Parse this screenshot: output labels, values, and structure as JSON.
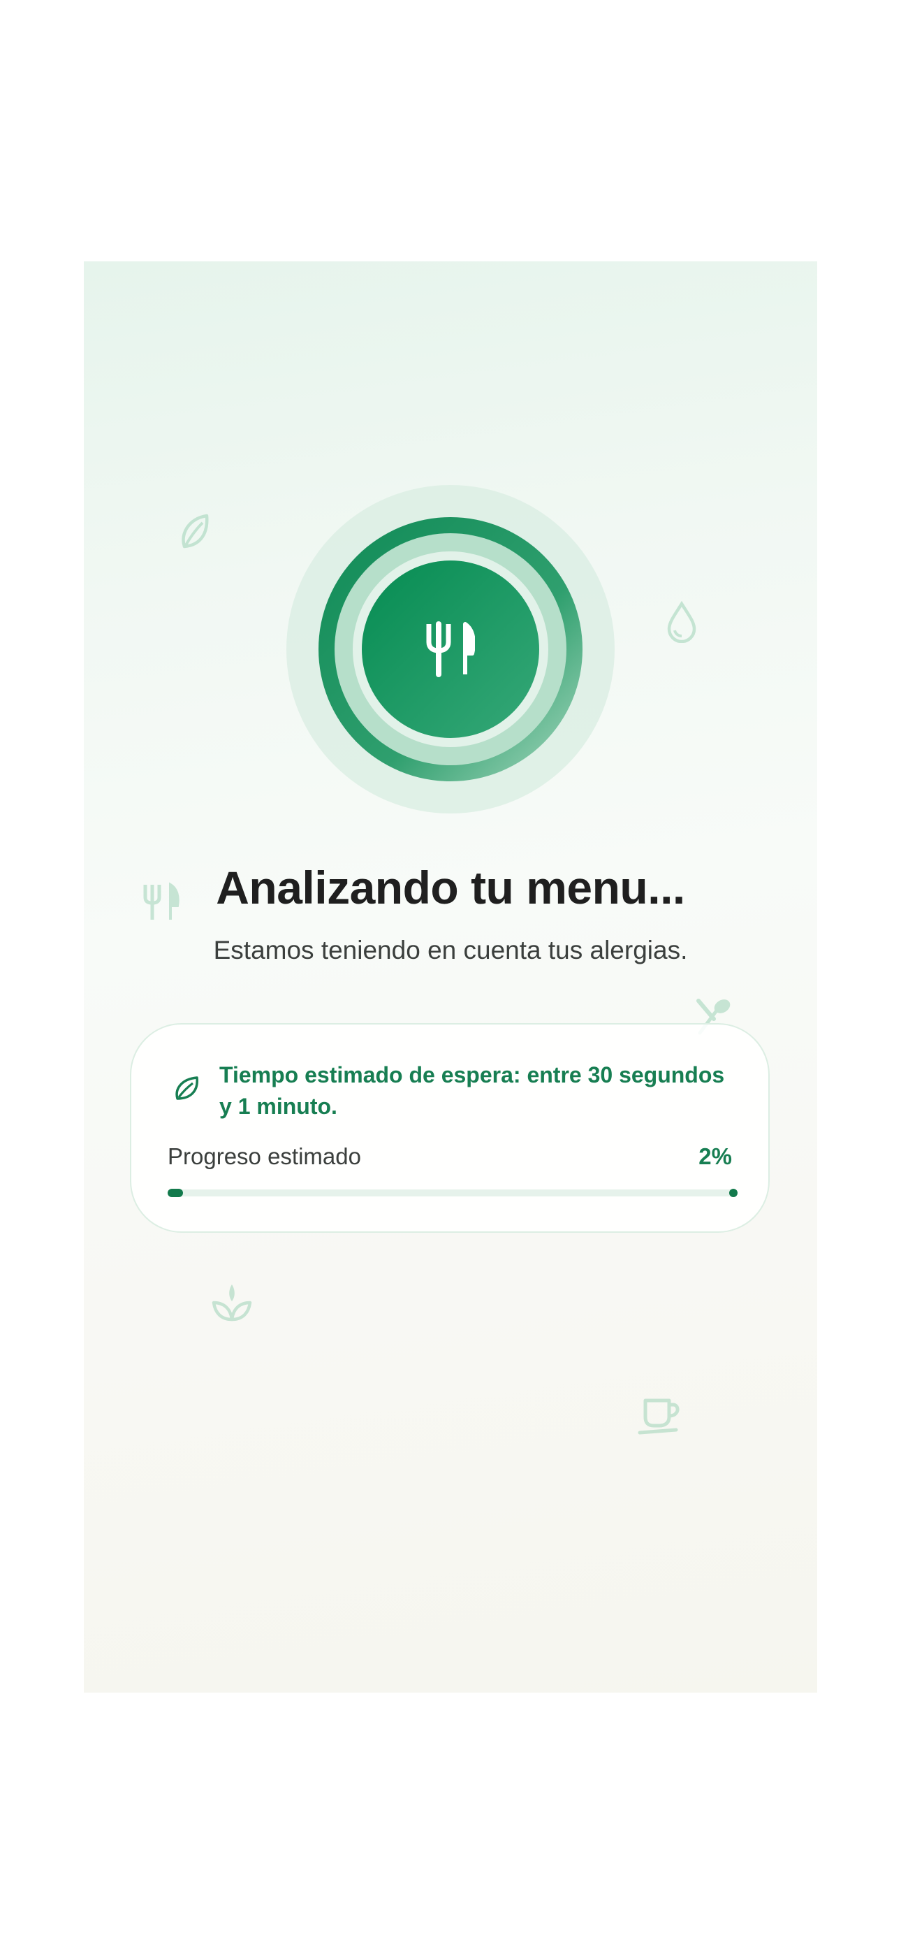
{
  "colors": {
    "accent": "#177e52",
    "accent_dark": "#0a8a55",
    "ring_light": "#dcefe4",
    "text_dark": "#1f1f1f",
    "text_body": "#3b3f3d"
  },
  "loader": {
    "icon": "fork-knife-icon"
  },
  "decorations": [
    "leaf-icon",
    "water-drop-icon",
    "fork-knife-icon",
    "spoon-icon",
    "sprout-icon",
    "coffee-cup-icon"
  ],
  "header": {
    "title": "Analizando tu menu...",
    "subtitle": "Estamos teniendo en cuenta tus alergias."
  },
  "status_card": {
    "icon": "leaf-icon",
    "wait_text": "Tiempo estimado de espera: entre 30 segundos y 1 minuto.",
    "progress_label": "Progreso estimado",
    "progress_value_text": "2%",
    "progress_percent": 2
  }
}
